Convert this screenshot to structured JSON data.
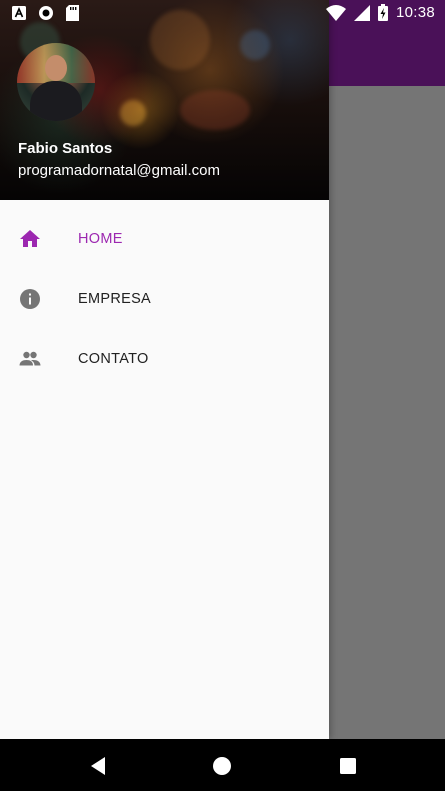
{
  "status_bar": {
    "time": "10:38",
    "left_icons": [
      "text-a-notification-icon",
      "circle-notification-icon",
      "sd-card-icon"
    ],
    "right_icons": [
      "wifi-icon",
      "signal-icon",
      "battery-charging-icon"
    ]
  },
  "drawer": {
    "header": {
      "user_name": "Fabio Santos",
      "user_email": "programadornatal@gmail.com"
    },
    "items": [
      {
        "label": "HOME",
        "icon": "home-icon",
        "active": true
      },
      {
        "label": "EMPRESA",
        "icon": "info-icon",
        "active": false
      },
      {
        "label": "CONTATO",
        "icon": "people-icon",
        "active": false
      }
    ]
  },
  "colors": {
    "accent": "#9c27b0",
    "app_bar": "#4a1158",
    "icon_gray": "#757575",
    "scrim_content": "#757575"
  },
  "nav_bar": {
    "buttons": [
      "back-icon",
      "home-circle-icon",
      "recents-icon"
    ]
  }
}
